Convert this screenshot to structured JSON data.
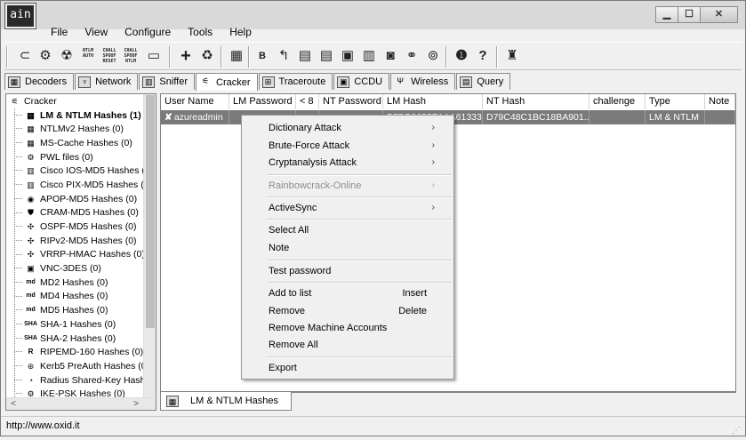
{
  "app": {
    "icon_text": "ain"
  },
  "menubar": [
    "File",
    "View",
    "Configure",
    "Tools",
    "Help"
  ],
  "toolbar": {
    "label_ntlm_auth": "NTLM AUTH",
    "label_chall_spoof_reset": "CHALL SPOOF RESET",
    "label_chall_spoof_ntlm": "CHALL SPOOF NTLM"
  },
  "tabs": [
    "Decoders",
    "Network",
    "Sniffer",
    "Cracker",
    "Traceroute",
    "CCDU",
    "Wireless",
    "Query"
  ],
  "tree": {
    "root": "Cracker",
    "items": [
      "LM & NTLM Hashes (1)",
      "NTLMv2 Hashes (0)",
      "MS-Cache Hashes (0)",
      "PWL files (0)",
      "Cisco IOS-MD5 Hashes (",
      "Cisco PIX-MD5 Hashes (",
      "APOP-MD5 Hashes (0)",
      "CRAM-MD5 Hashes (0)",
      "OSPF-MD5 Hashes (0)",
      "RIPv2-MD5 Hashes (0)",
      "VRRP-HMAC Hashes (0)",
      "VNC-3DES (0)",
      "MD2 Hashes (0)",
      "MD4 Hashes (0)",
      "MD5 Hashes (0)",
      "SHA-1 Hashes (0)",
      "SHA-2 Hashes (0)",
      "RIPEMD-160 Hashes (0)",
      "Kerb5 PreAuth Hashes (0",
      "Radius Shared-Key Hash",
      "IKE-PSK Hashes (0)"
    ]
  },
  "grid": {
    "columns": [
      "User Name",
      "LM Password",
      "< 8",
      "NT Password",
      "LM Hash",
      "NT Hash",
      "challenge",
      "Type",
      "Note"
    ],
    "rows": [
      {
        "user": "azureadmin",
        "lm_password": "",
        "lt8": "",
        "nt_password": "",
        "lm_hash": "B7DB0655E1AA61333...",
        "nt_hash": "D79C48C1BC18BA901...",
        "challenge": "",
        "type": "LM & NTLM",
        "note": ""
      }
    ]
  },
  "bottom_tab": "LM & NTLM Hashes",
  "status": "http://www.oxid.it",
  "context_menu": {
    "dictionary_attack": "Dictionary Attack",
    "brute_force_attack": "Brute-Force Attack",
    "cryptanalysis_attack": "Cryptanalysis Attack",
    "rainbowcrack_online": "Rainbowcrack-Online",
    "activesync": "ActiveSync",
    "select_all": "Select All",
    "note": "Note",
    "test_password": "Test password",
    "add_to_list": "Add to list",
    "add_to_list_shortcut": "Insert",
    "remove": "Remove",
    "remove_shortcut": "Delete",
    "remove_machine_accounts": "Remove Machine Accounts",
    "remove_all": "Remove All",
    "export": "Export"
  }
}
